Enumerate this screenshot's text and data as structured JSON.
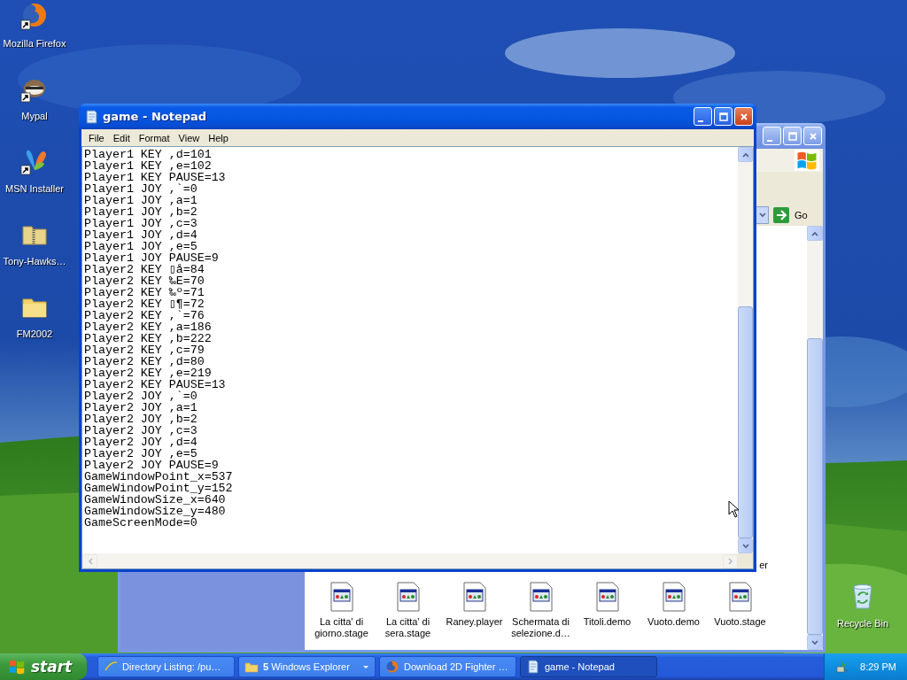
{
  "desktop_icons": [
    {
      "label": "Mozilla Firefox",
      "kind": "firefox",
      "shortcut": true
    },
    {
      "label": "Mypal",
      "kind": "mypal",
      "shortcut": true
    },
    {
      "label": "MSN Installer",
      "kind": "msn",
      "shortcut": true
    },
    {
      "label": "Tony-Hawks…",
      "kind": "zip",
      "shortcut": false
    },
    {
      "label": "FM2002",
      "kind": "folder",
      "shortcut": false
    }
  ],
  "recycle_bin": {
    "label": "Recycle Bin"
  },
  "explorer": {
    "go_label": "Go",
    "upper_row_label": "er",
    "files": [
      {
        "label": "La citta' di giorno.stage"
      },
      {
        "label": "La citta' di sera.stage"
      },
      {
        "label": "Raney.player"
      },
      {
        "label": "Schermata di selezione.d…"
      },
      {
        "label": "Titoli.demo"
      },
      {
        "label": "Vuoto.demo"
      },
      {
        "label": "Vuoto.stage"
      }
    ]
  },
  "notepad": {
    "title": "game - Notepad",
    "menu": [
      "File",
      "Edit",
      "Format",
      "View",
      "Help"
    ],
    "lines": [
      "Player1 KEY ,d=101",
      "Player1 KEY ,e=102",
      "Player1 KEY PAUSE=13",
      "Player1 JOY ,`=0",
      "Player1 JOY ,a=1",
      "Player1 JOY ,b=2",
      "Player1 JOY ,c=3",
      "Player1 JOY ,d=4",
      "Player1 JOY ,e=5",
      "Player1 JOY PAUSE=9",
      "Player2 KEY ▯å=84",
      "Player2 KEY ‰E=70",
      "Player2 KEY ‰º=71",
      "Player2 KEY ▯¶=72",
      "Player2 KEY ,`=76",
      "Player2 KEY ,a=186",
      "Player2 KEY ,b=222",
      "Player2 KEY ,c=79",
      "Player2 KEY ,d=80",
      "Player2 KEY ,e=219",
      "Player2 KEY PAUSE=13",
      "Player2 JOY ,`=0",
      "Player2 JOY ,a=1",
      "Player2 JOY ,b=2",
      "Player2 JOY ,c=3",
      "Player2 JOY ,d=4",
      "Player2 JOY ,e=5",
      "Player2 JOY PAUSE=9",
      "GameWindowPoint_x=537",
      "GameWindowPoint_y=152",
      "GameWindowSize_x=640",
      "GameWindowSize_y=480",
      "GameScreenMode=0"
    ]
  },
  "taskbar": {
    "start": "start",
    "tasks": [
      {
        "label": "Directory Listing: /pu…",
        "kind": "ie",
        "grouped": false,
        "selected": false
      },
      {
        "label": "**5** Windows Explorer",
        "kind": "folder",
        "grouped": true,
        "selected": false
      },
      {
        "label": "Download 2D Fighter …",
        "kind": "firefox",
        "grouped": false,
        "selected": false
      },
      {
        "label": "game - Notepad",
        "kind": "notepad",
        "grouped": false,
        "selected": true
      }
    ],
    "clock": "8:29 PM"
  }
}
